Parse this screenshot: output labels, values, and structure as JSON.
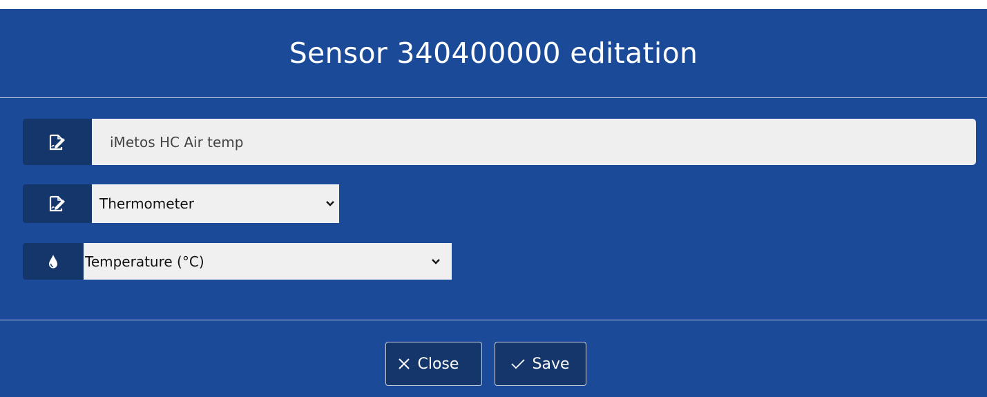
{
  "dialog": {
    "title": "Sensor 340400000 editation"
  },
  "fields": {
    "name": {
      "icon": "edit-document-icon",
      "value": "iMetos HC Air temp",
      "placeholder": ""
    },
    "type": {
      "icon": "edit-document-icon",
      "selected": "Thermometer"
    },
    "unit": {
      "icon": "water-drop-icon",
      "selected": "Temperature (°C)"
    }
  },
  "footer": {
    "close_label": "Close",
    "close_icon": "close-icon",
    "save_label": "Save",
    "save_icon": "check-icon"
  },
  "colors": {
    "background": "#1b4b98",
    "icon_box": "#15366b",
    "field": "#efefef",
    "text": "#ffffff"
  }
}
